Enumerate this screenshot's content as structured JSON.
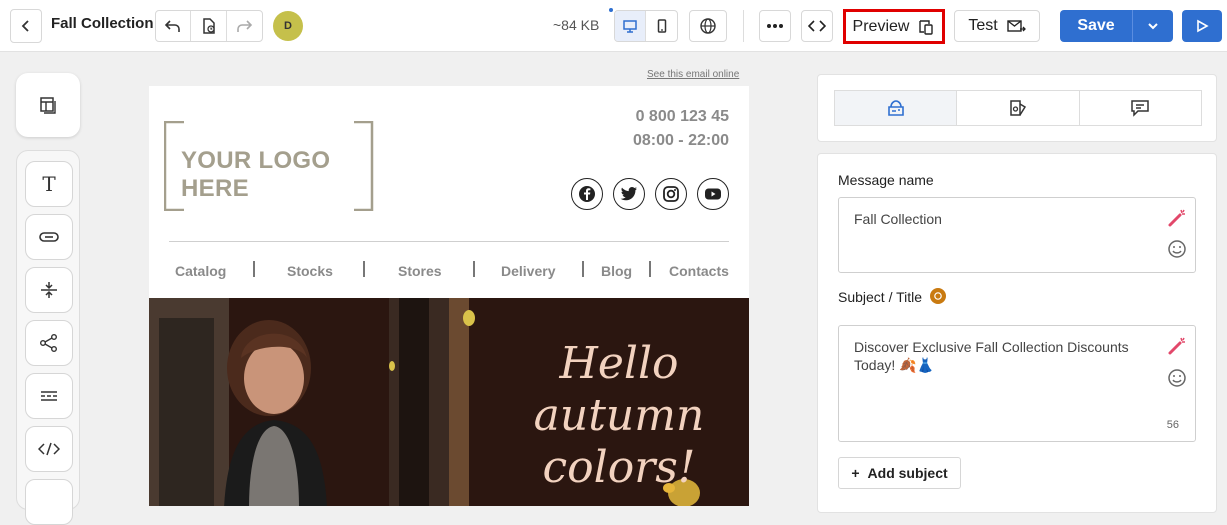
{
  "header": {
    "title": "Fall Collection",
    "avatar_initial": "D",
    "email_size": "~84 KB",
    "preview_label": "Preview",
    "test_label": "Test",
    "save_label": "Save",
    "highlight_color": "#e00000",
    "primary_color": "#2f6fd0"
  },
  "email": {
    "see_online": "See this email online",
    "logo_text": "YOUR LOGO HERE",
    "phone": "0 800 123 45",
    "hours": "08:00 - 22:00",
    "social_icons": [
      "facebook-icon",
      "twitter-icon",
      "instagram-icon",
      "youtube-icon"
    ],
    "nav": [
      "Catalog",
      "Stocks",
      "Stores",
      "Delivery",
      "Blog",
      "Contacts"
    ],
    "hero_lines": [
      "Hello",
      "autumn",
      "colors!"
    ]
  },
  "panel": {
    "tabs": [
      "settings-tab-icon",
      "design-tab-icon",
      "comments-tab-icon"
    ],
    "message_name_label": "Message name",
    "message_name_value": "Fall Collection",
    "subject_label": "Subject / Title",
    "subject_value": "Discover Exclusive Fall Collection Discounts Today! 🍂👗",
    "subject_count": "56",
    "add_subject_label": "Add subject"
  }
}
